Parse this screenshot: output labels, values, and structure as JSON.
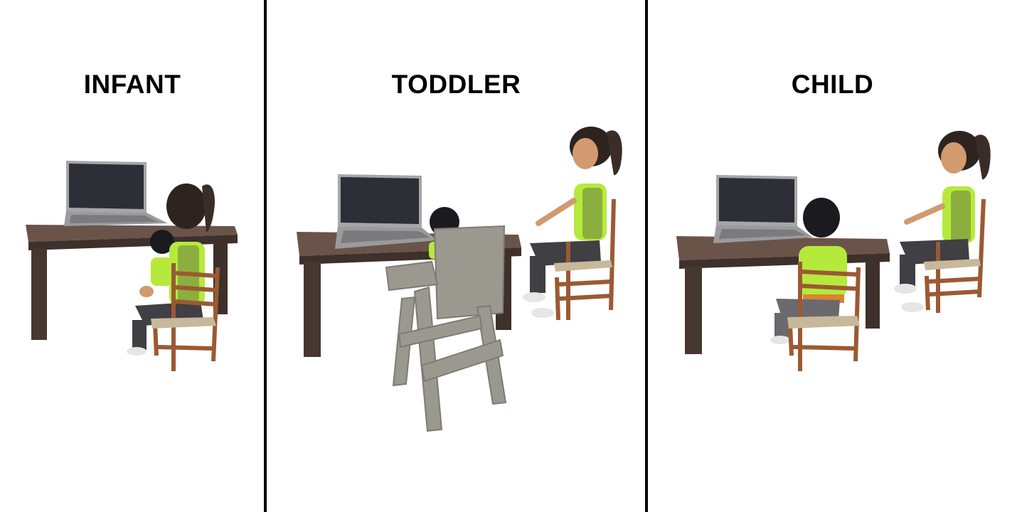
{
  "panels": [
    {
      "label": "INFANT"
    },
    {
      "label": "TODDLER"
    },
    {
      "label": "CHILD"
    }
  ],
  "colors": {
    "desk": "#4a3a33",
    "desk_top": "#5e4a42",
    "laptop_body": "#9a9a9c",
    "laptop_screen": "#2d2e36",
    "chair_wood": "#9a5a33",
    "highchair": "#9b9890",
    "shirt": "#b5ea3c",
    "pants": "#3f3f44",
    "skin": "#d29a6e",
    "hair": "#2e241f",
    "child_hair": "#1b1b1f"
  }
}
